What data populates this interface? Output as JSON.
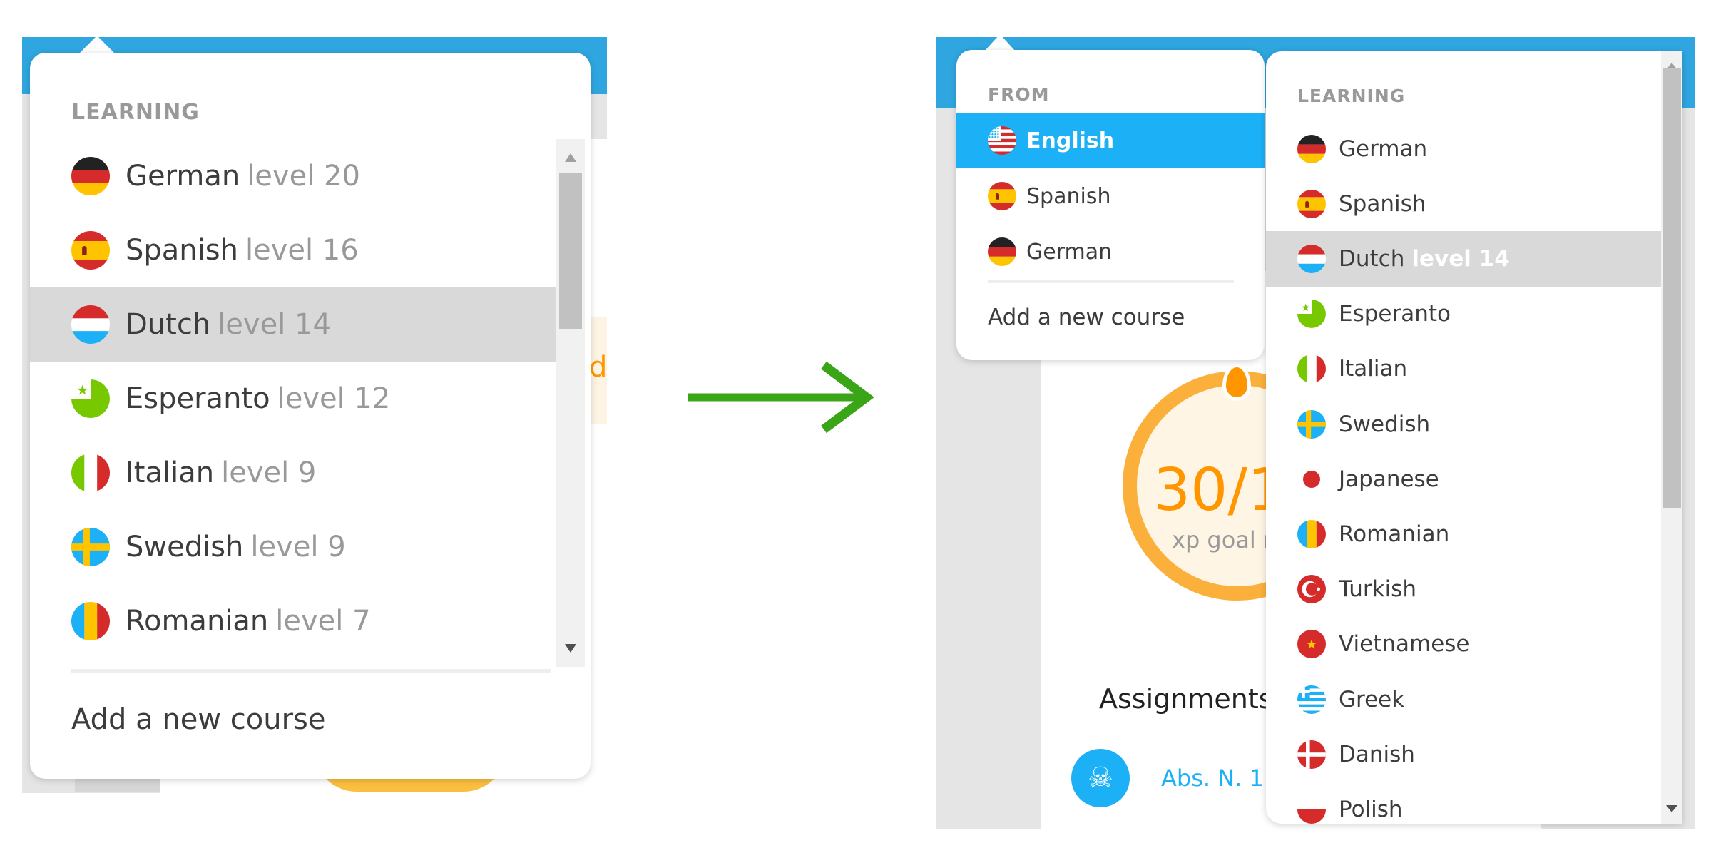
{
  "colors": {
    "brand_blue": "#1cb0f6",
    "header_blue": "#2fa6e0",
    "highlight": "#d9d9d9",
    "arrow": "#3aa516",
    "orange": "#ff9600"
  },
  "before": {
    "section_label": "LEARNING",
    "items": [
      {
        "flag": "de",
        "name": "German",
        "level": "level 20"
      },
      {
        "flag": "es",
        "name": "Spanish",
        "level": "level 16"
      },
      {
        "flag": "nl",
        "name": "Dutch",
        "level": "level 14",
        "highlighted": true
      },
      {
        "flag": "eo",
        "name": "Esperanto",
        "level": "level 12"
      },
      {
        "flag": "it",
        "name": "Italian",
        "level": "level 9"
      },
      {
        "flag": "se",
        "name": "Swedish",
        "level": "level 9"
      },
      {
        "flag": "ro",
        "name": "Romanian",
        "level": "level 7"
      }
    ],
    "add_course": "Add a new course",
    "bg_partial_text": "d"
  },
  "arrow_icon": "right-arrow-icon",
  "after": {
    "from": {
      "section_label": "FROM",
      "items": [
        {
          "flag": "us",
          "name": "English",
          "selected": true
        },
        {
          "flag": "es",
          "name": "Spanish"
        },
        {
          "flag": "de",
          "name": "German"
        }
      ],
      "add_course": "Add a new course"
    },
    "learning": {
      "section_label": "LEARNING",
      "items": [
        {
          "flag": "de",
          "name": "German"
        },
        {
          "flag": "es",
          "name": "Spanish"
        },
        {
          "flag": "nl",
          "name": "Dutch",
          "level": "level 14",
          "highlighted": true
        },
        {
          "flag": "eo",
          "name": "Esperanto"
        },
        {
          "flag": "it",
          "name": "Italian"
        },
        {
          "flag": "se",
          "name": "Swedish"
        },
        {
          "flag": "jp",
          "name": "Japanese"
        },
        {
          "flag": "ro",
          "name": "Romanian"
        },
        {
          "flag": "tr",
          "name": "Turkish"
        },
        {
          "flag": "vn",
          "name": "Vietnamese"
        },
        {
          "flag": "gr",
          "name": "Greek"
        },
        {
          "flag": "dk",
          "name": "Danish"
        },
        {
          "flag": "pl",
          "name": "Polish"
        }
      ]
    },
    "background": {
      "xp_value": "30/1",
      "xp_label": "xp goal r",
      "assignments_title": "Assignments",
      "assignment": "Abs. N. 1"
    }
  }
}
